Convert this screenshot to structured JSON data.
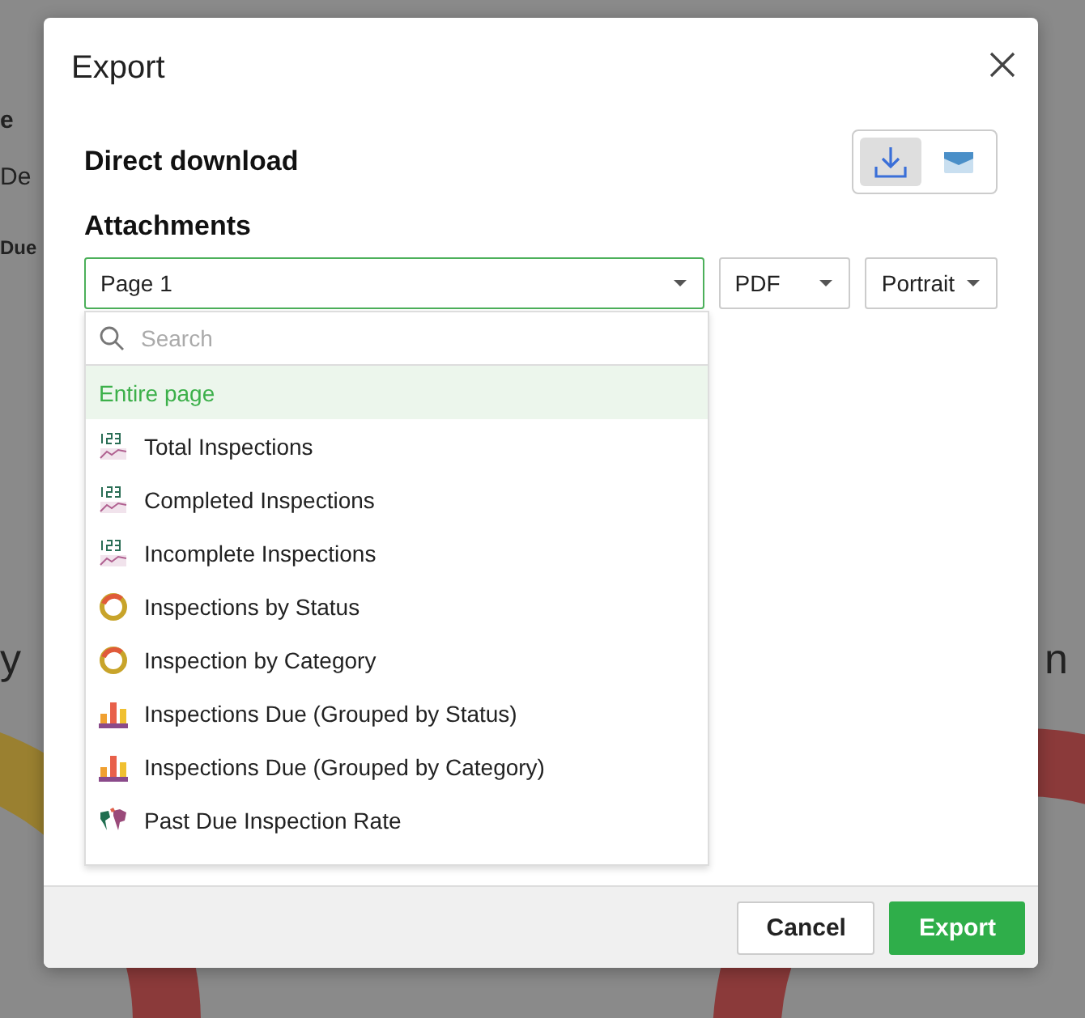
{
  "background": {
    "fragments": [
      "e",
      "De",
      "Due",
      "y",
      "n"
    ]
  },
  "dialog": {
    "title": "Export",
    "sections": [
      "Direct download",
      "Attachments"
    ],
    "delivery": [
      {
        "kind": "download",
        "selected": true
      },
      {
        "kind": "email",
        "selected": false
      }
    ],
    "page_select": {
      "value": "Page 1"
    },
    "format_select": {
      "value": "PDF"
    },
    "orientation_select": {
      "value": "Portrait"
    },
    "search": {
      "placeholder": "Search"
    },
    "options": [
      {
        "label": "Entire page",
        "kind": "page",
        "selected": true
      },
      {
        "label": "Total Inspections",
        "kind": "kpi",
        "selected": false
      },
      {
        "label": "Completed Inspections",
        "kind": "kpi",
        "selected": false
      },
      {
        "label": "Incomplete Inspections",
        "kind": "kpi",
        "selected": false
      },
      {
        "label": "Inspections by Status",
        "kind": "donut",
        "selected": false
      },
      {
        "label": "Inspection by Category",
        "kind": "donut",
        "selected": false
      },
      {
        "label": "Inspections Due  (Grouped by Status)",
        "kind": "bar",
        "selected": false
      },
      {
        "label": "Inspections Due (Grouped by Category)",
        "kind": "bar",
        "selected": false
      },
      {
        "label": "Past Due Inspection Rate",
        "kind": "map",
        "selected": false
      }
    ],
    "buttons": [
      {
        "label": "Cancel",
        "kind": "secondary"
      },
      {
        "label": "Export",
        "kind": "primary"
      }
    ]
  }
}
